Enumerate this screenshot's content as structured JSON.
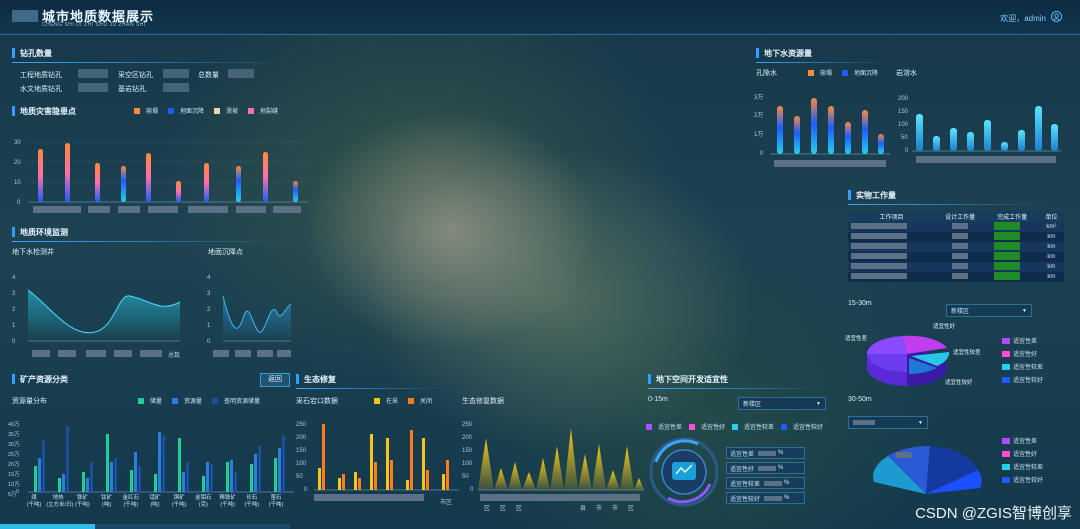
{
  "header": {
    "title": "城市地质数据展示",
    "subtitle": "CHENG SHI DI ZHI SHU JU ZHAN SHI",
    "welcome": "欢迎，admin"
  },
  "drill": {
    "title": "钻孔数量",
    "labels": [
      "工程地质钻孔",
      "采空区钻孔",
      "总数量",
      "水文地质钻孔",
      "基岩钻孔"
    ]
  },
  "hazard": {
    "title": "地质灾害隐患点",
    "legend": [
      "崩塌",
      "地面沉降",
      "滑坡",
      "地裂缝"
    ],
    "yticks": [
      "30",
      "20",
      "10",
      "0"
    ]
  },
  "env": {
    "title": "地质环境监测",
    "well_label": "地下水检测井",
    "subsidence_label": "地面沉降点",
    "total": "总数",
    "yticks": [
      "4",
      "3",
      "2",
      "1",
      "0"
    ]
  },
  "mineral": {
    "title": "矿产资源分类",
    "back": "返回",
    "dist_label": "资源量分布",
    "legend": [
      "储量",
      "资源量",
      "查明资源储量"
    ],
    "yticks": [
      "40万",
      "35万",
      "30万",
      "25万",
      "20万",
      "15万",
      "10万",
      "5万",
      "0"
    ],
    "categories": [
      "煤\n(千吨)",
      "地热\n(立方米/日)",
      "铁矿\n(千吨)",
      "钛矿\n(吨)",
      "金红石\n(千吨)",
      "锰矿\n(吨)",
      "铜矿\n(千吨)",
      "金钼石\n(克)",
      "稀铁矿\n(千吨)",
      "长石\n(千吨)",
      "萤石\n(千吨)"
    ]
  },
  "eco": {
    "title": "生态修复",
    "quarry_label": "采石宕口数据",
    "legend": [
      "在采",
      "关闭"
    ],
    "restore_label": "生态修复数据",
    "city": "市区",
    "yticks": [
      "250",
      "200",
      "150",
      "100",
      "50",
      "0"
    ],
    "x_restore": [
      "区",
      "区",
      "区",
      "县",
      "市",
      "市",
      "区"
    ]
  },
  "groundwater": {
    "title": "地下水资源量",
    "pore_label": "孔隙水",
    "bedrock_label": "岩溶水",
    "legend": [
      "崩塌",
      "地面沉降"
    ],
    "left_ticks": [
      "3万",
      "2万",
      "1万",
      "0"
    ],
    "right_ticks": [
      "200",
      "150",
      "100",
      "50",
      "0"
    ]
  },
  "work": {
    "title": "实物工作量",
    "headers": [
      "工作项目",
      "设计工作量",
      "完成工作量",
      "单位"
    ],
    "units": [
      "km²",
      "km",
      "km",
      "km",
      "km",
      "km"
    ]
  },
  "suit1": {
    "depth": "15-30m",
    "district": "新楼区",
    "labels": [
      "适宜性差",
      "适宜性好",
      "适宜性较差",
      "适宜性较好"
    ]
  },
  "suit2": {
    "depth": "30-50m"
  },
  "under": {
    "title": "地下空间开发适宜性",
    "depth": "0-15m",
    "district": "新楼区",
    "legend": [
      "适宜性差",
      "适宜性好",
      "适宜性较差",
      "适宜性较好"
    ],
    "rows": [
      "适宜性差",
      "适宜性好",
      "适宜性较差",
      "适宜性较好"
    ],
    "pct": "%"
  },
  "watermark": "CSDN @ZGIS智博创享",
  "colors": {
    "orange": "#ff8a3a",
    "blue": "#1c5cff",
    "cyan": "#26d0e8",
    "teal": "#1fcf9a",
    "yellow": "#f5c518",
    "pink": "#ff6fa8",
    "purple": "#b04dff",
    "violet": "#7b52ff"
  }
}
